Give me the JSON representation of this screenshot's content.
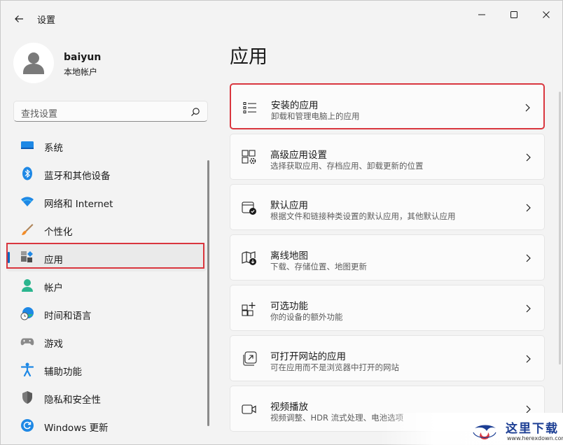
{
  "window": {
    "title": "设置"
  },
  "profile": {
    "name": "baiyun",
    "account_type": "本地帐户"
  },
  "search": {
    "placeholder": "查找设置"
  },
  "sidebar": {
    "items": [
      {
        "label": "系统",
        "icon": "system-icon"
      },
      {
        "label": "蓝牙和其他设备",
        "icon": "bluetooth-icon"
      },
      {
        "label": "网络和 Internet",
        "icon": "wifi-icon"
      },
      {
        "label": "个性化",
        "icon": "brush-icon"
      },
      {
        "label": "应用",
        "icon": "apps-icon",
        "selected": true
      },
      {
        "label": "帐户",
        "icon": "account-icon"
      },
      {
        "label": "时间和语言",
        "icon": "time-language-icon"
      },
      {
        "label": "游戏",
        "icon": "gamepad-icon"
      },
      {
        "label": "辅助功能",
        "icon": "accessibility-icon"
      },
      {
        "label": "隐私和安全性",
        "icon": "shield-icon"
      },
      {
        "label": "Windows 更新",
        "icon": "update-icon"
      }
    ]
  },
  "main": {
    "title": "应用",
    "cards": [
      {
        "title": "安装的应用",
        "subtitle": "卸载和管理电脑上的应用",
        "icon": "list-icon"
      },
      {
        "title": "高级应用设置",
        "subtitle": "选择获取应用、存档应用、卸载更新的位置",
        "icon": "app-settings-icon"
      },
      {
        "title": "默认应用",
        "subtitle": "根据文件和链接种类设置的默认应用，其他默认应用",
        "icon": "default-apps-icon"
      },
      {
        "title": "离线地图",
        "subtitle": "下载、存储位置、地图更新",
        "icon": "map-icon"
      },
      {
        "title": "可选功能",
        "subtitle": "你的设备的额外功能",
        "icon": "optional-features-icon"
      },
      {
        "title": "可打开网站的应用",
        "subtitle": "可在应用而不是浏览器中打开的网站",
        "icon": "open-website-icon"
      },
      {
        "title": "视频播放",
        "subtitle": "视频调整、HDR 流式处理、电池选项",
        "icon": "video-icon"
      }
    ]
  },
  "watermark": {
    "text": "这里下载",
    "url": "www.herexdown.com"
  },
  "colors": {
    "accent": "#0067c0",
    "highlight": "#d9363e"
  }
}
